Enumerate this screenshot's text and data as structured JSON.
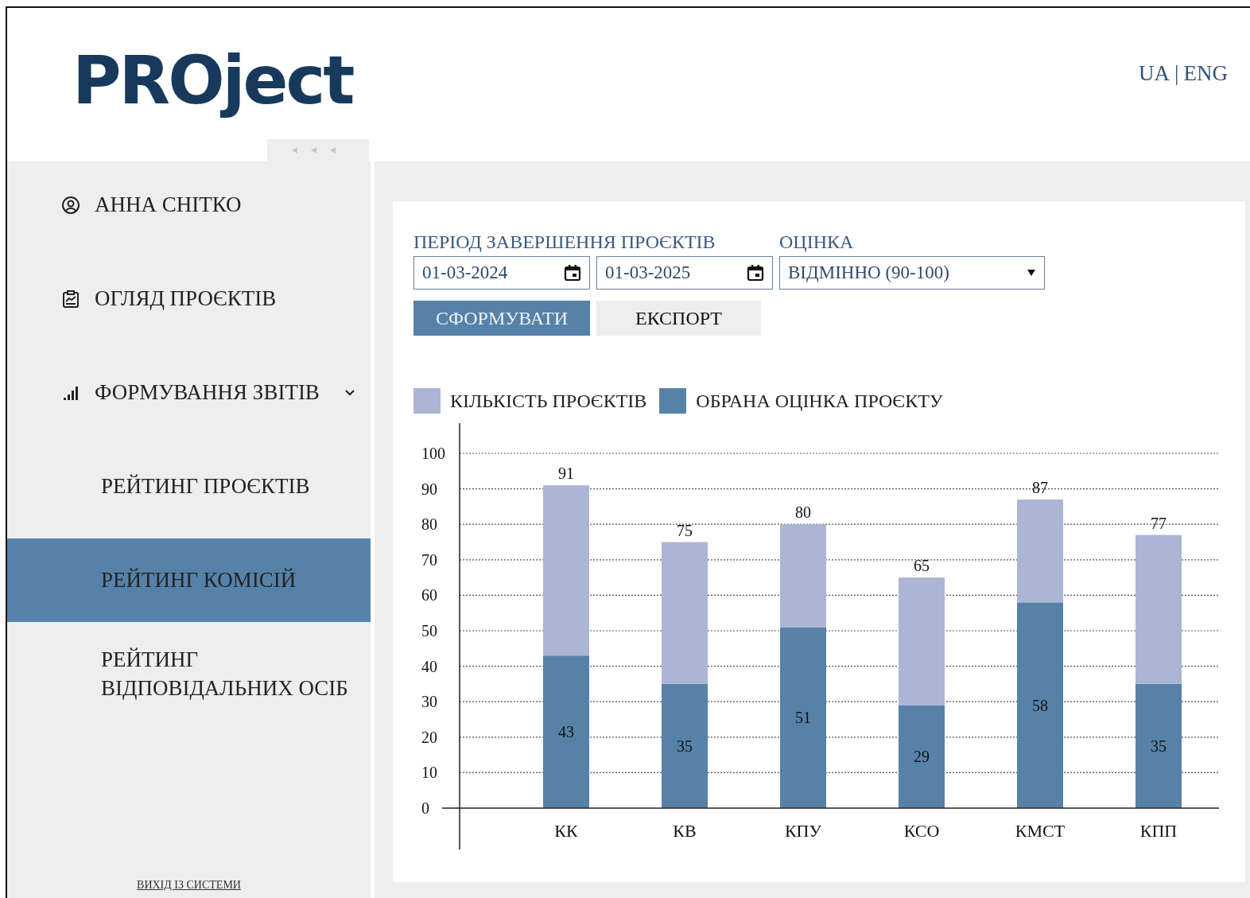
{
  "logo": "PROject",
  "language_switch": {
    "items": [
      "UA",
      "ENG"
    ],
    "separator": "|"
  },
  "sidebar": {
    "items": [
      {
        "label": "АННА СНІТКО",
        "kind": "user",
        "selected": false
      },
      {
        "label": "ОГЛЯД ПРОЄКТІВ",
        "kind": "overview",
        "selected": false
      },
      {
        "label": "ФОРМУВАННЯ ЗВІТІВ",
        "kind": "reports",
        "expanded": true,
        "selected": false,
        "children": [
          {
            "label": "РЕЙТИНГ ПРОЄКТІВ",
            "selected": false
          },
          {
            "label": "РЕЙТИНГ КОМІСІЙ",
            "selected": true
          },
          {
            "label": "РЕЙТИНГ ВІДПОВІДАЛЬНИХ ОСІБ",
            "selected": false
          }
        ]
      }
    ],
    "logout": "ВИХІД ІЗ СИСТЕМИ"
  },
  "filters": {
    "period_label": "ПЕРІОД ЗАВЕРШЕННЯ ПРОЄКТІВ",
    "date_from": "01-03-2024",
    "date_to": "01-03-2025",
    "rating_label": "ОЦІНКА",
    "rating_value": "ВІДМІННО (90-100)"
  },
  "buttons": [
    "СФОРМУВАТИ",
    "ЕКСПОРТ"
  ],
  "chart_data": {
    "type": "bar",
    "categories": [
      "КК",
      "КВ",
      "КПУ",
      "КСО",
      "КМСТ",
      "КПП"
    ],
    "series": [
      {
        "name": "КІЛЬКІСТЬ ПРОЄКТІВ",
        "color": "#adb5d6",
        "values": [
          48,
          40,
          29,
          36,
          29,
          42
        ]
      },
      {
        "name": "ОБРАНА ОЦІНКА ПРОЄКТУ",
        "color": "#5782a8",
        "values": [
          43,
          35,
          51,
          29,
          58,
          35
        ]
      }
    ],
    "stacked": true,
    "grid": true,
    "value_labels": [
      [
        "91",
        "75",
        "80",
        "65",
        "87",
        "77"
      ],
      [
        "43",
        "35",
        "51",
        "29",
        "58",
        "35"
      ]
    ],
    "ylim": [
      0,
      100
    ],
    "yticks": [
      0,
      10,
      20,
      30,
      40,
      50,
      60,
      70,
      80,
      90,
      100
    ]
  }
}
